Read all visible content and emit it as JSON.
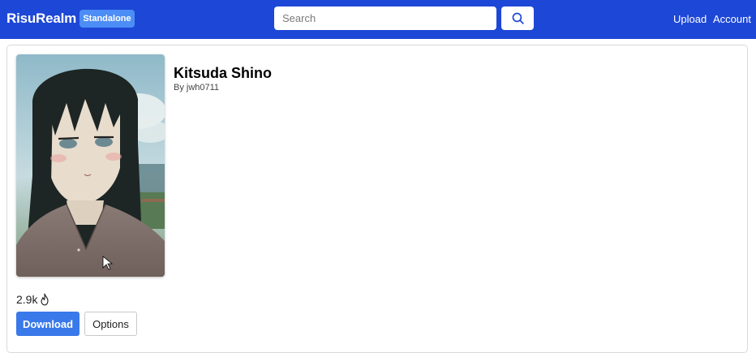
{
  "header": {
    "brand": "RisuRealm",
    "badge": "Standalone",
    "search": {
      "placeholder": "Search",
      "value": ""
    },
    "nav": {
      "upload": "Upload",
      "account": "Account"
    },
    "colors": {
      "bar": "#1d47d6",
      "badge": "#4c8df6"
    }
  },
  "character": {
    "name": "Kitsuda Shino",
    "author": "By jwh0711",
    "image_icon": "character-portrait"
  },
  "stats": {
    "downloads": "2.9k",
    "icon": "flame-icon"
  },
  "actions": {
    "download": "Download",
    "options": "Options",
    "download_color": "#3979e9"
  }
}
